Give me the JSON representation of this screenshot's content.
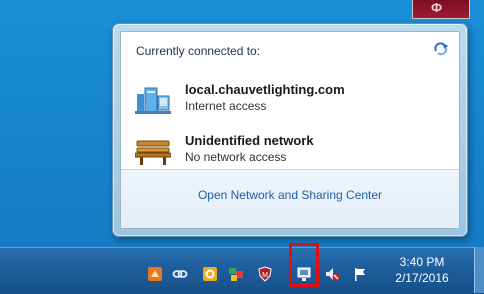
{
  "flyout": {
    "header": "Currently connected to:",
    "networks": [
      {
        "name": "local.chauvetlighting.com",
        "status": "Internet access",
        "icon": "domain-network-icon"
      },
      {
        "name": "Unidentified network",
        "status": "No network access",
        "icon": "public-network-bench-icon"
      }
    ],
    "footer_link": "Open Network and Sharing Center"
  },
  "clock": {
    "time": "3:40 PM",
    "date": "2/17/2016"
  },
  "colors": {
    "desktop": "#1682cc",
    "highlight": "#e01010",
    "link": "#1f5fa8"
  }
}
